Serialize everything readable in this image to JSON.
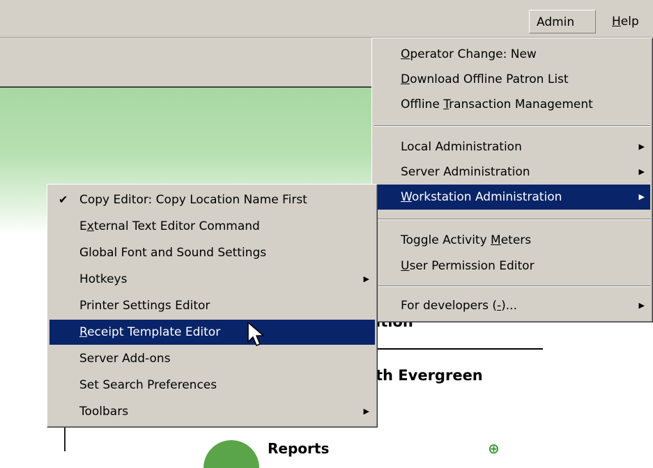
{
  "menubar": {
    "admin": {
      "pre": "Admin (",
      "hot": "-",
      "post": ")"
    },
    "help": {
      "hot": "H",
      "post": "elp"
    }
  },
  "portal": {
    "heading": "ition",
    "subtitle": "th Evergreen",
    "reports": "Reports",
    "plus_glyph": "⊕"
  },
  "admin_menu": {
    "operator_change": {
      "hot": "O",
      "post": "perator Change: New"
    },
    "download_offline": {
      "hot": "D",
      "post": "ownload Offline Patron List"
    },
    "offline_txn": {
      "pre": "Offline ",
      "hot": "T",
      "post": "ransaction Management"
    },
    "local_admin": "Local Administration",
    "server_admin": "Server Administration",
    "workstation_admin": {
      "hot": "W",
      "post": "orkstation Administration"
    },
    "toggle_meters": {
      "pre": "Toggle Activity ",
      "hot": "M",
      "post": "eters"
    },
    "user_perm": {
      "hot": "U",
      "post": "ser Permission Editor"
    },
    "for_developers": {
      "pre": "For developers (",
      "hot": "-",
      "post": ")..."
    }
  },
  "workstation_submenu": {
    "copy_editor": "Copy Editor: Copy Location Name First",
    "external_text": {
      "pre": "E",
      "hot": "x",
      "post": "ternal Text Editor Command"
    },
    "global_font": "Global Font and Sound Settings",
    "hotkeys": "Hotkeys",
    "printer_settings": "Printer Settings Editor",
    "receipt_template": {
      "hot": "R",
      "post": "eceipt Template Editor"
    },
    "server_addons": "Server Add-ons",
    "search_prefs": "Set Search Preferences",
    "toolbars": "Toolbars"
  },
  "glyphs": {
    "arrow": "▶",
    "check": "✔"
  }
}
